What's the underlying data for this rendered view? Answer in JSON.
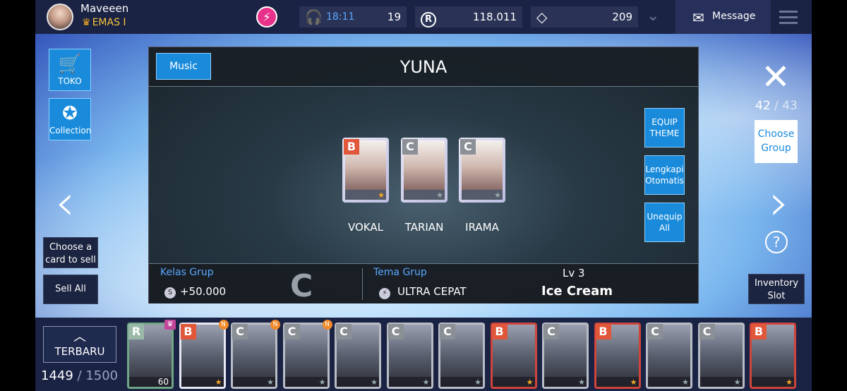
{
  "user": {
    "name": "Maveeen",
    "rank": "EMAS I"
  },
  "stats": [
    {
      "icon": "headphones-icon",
      "text": "18:11",
      "value": "19"
    },
    {
      "icon": "r-coin-icon",
      "symbol": "R",
      "value": "118.011"
    },
    {
      "icon": "diamond-icon",
      "value": "209"
    }
  ],
  "message_label": "Message",
  "sidebar": {
    "toko_label": "TOKO",
    "collection_label": "Collection",
    "choose_card_label": "Choose a card to sell",
    "sell_all_label": "Sell All"
  },
  "right": {
    "count_current": "42",
    "count_total": "43",
    "choose_group_label": "Choose Group",
    "help_label": "?",
    "inventory_label": "Inventory Slot"
  },
  "panel": {
    "tab_label": "Music",
    "title": "YUNA",
    "slots": [
      {
        "grade": "B",
        "label": "VOKAL"
      },
      {
        "grade": "C",
        "label": "TARIAN"
      },
      {
        "grade": "C",
        "label": "IRAMA"
      }
    ],
    "equip_label": "EQUIP THEME",
    "lengkapi_label": "Lengkapi Otomatis",
    "unequip_label": "Unequip All",
    "kelas_label": "Kelas Grup",
    "kelas_value": "+50.000",
    "kelas_grade": "C",
    "tema_label": "Tema Grup",
    "tema_value": "ULTRA CEPAT",
    "lv_label": "Lv 3",
    "theme_name": "Ice Cream"
  },
  "bottom": {
    "sort_label": "TERBARU",
    "count_current": "1449",
    "count_total": "1500",
    "cards": [
      {
        "grade": "R",
        "level": "60",
        "frame": "gr",
        "badge": "crown"
      },
      {
        "grade": "B",
        "frame": "w",
        "badge": "N"
      },
      {
        "grade": "C",
        "frame": "g",
        "badge": "N"
      },
      {
        "grade": "C",
        "frame": "g",
        "badge": "N"
      },
      {
        "grade": "C",
        "frame": "g",
        "badge": ""
      },
      {
        "grade": "C",
        "frame": "g",
        "badge": ""
      },
      {
        "grade": "C",
        "frame": "g",
        "badge": ""
      },
      {
        "grade": "B",
        "frame": "r",
        "badge": ""
      },
      {
        "grade": "C",
        "frame": "g",
        "badge": ""
      },
      {
        "grade": "B",
        "frame": "r",
        "badge": ""
      },
      {
        "grade": "C",
        "frame": "g",
        "badge": ""
      },
      {
        "grade": "C",
        "frame": "g",
        "badge": ""
      },
      {
        "grade": "B",
        "frame": "r",
        "badge": ""
      }
    ]
  }
}
